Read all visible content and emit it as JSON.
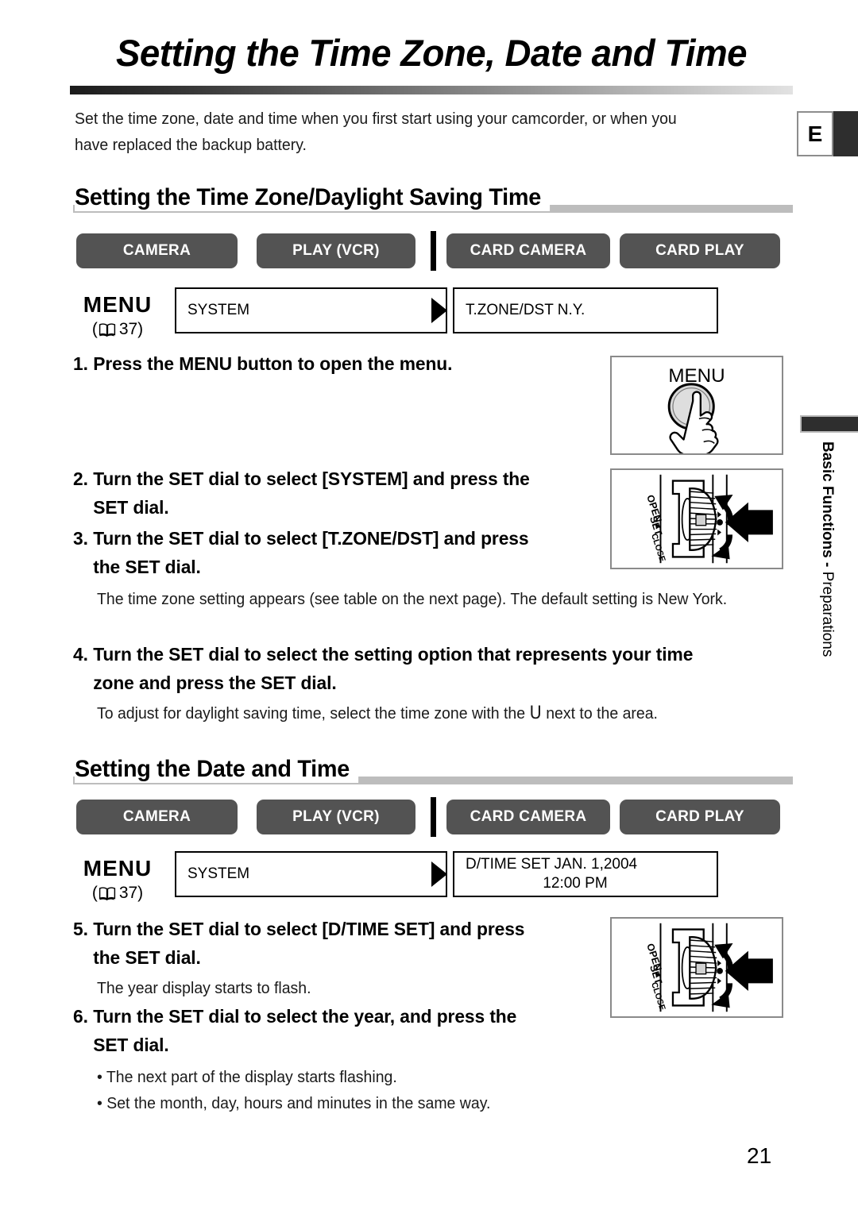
{
  "page": {
    "title": "Setting the Time Zone, Date and Time",
    "intro": "Set the time zone, date and time when you first start using your camcorder, or when you have replaced the backup battery.",
    "number": "21",
    "language_tab": "E"
  },
  "side_tab": {
    "line_bold": "Basic Functions -",
    "line_regular": "Preparations"
  },
  "section1": {
    "heading": "Setting the Time Zone/Daylight Saving Time",
    "modes": [
      {
        "label": "CAMERA"
      },
      {
        "label": "PLAY (VCR)"
      },
      {
        "label": "CARD CAMERA"
      },
      {
        "label": "CARD PLAY"
      }
    ],
    "menu": {
      "label": "MENU",
      "page_ref": "37",
      "box1": "SYSTEM",
      "box2_line1": "T.ZONE/DST  N.Y.",
      "box2_line2": ""
    },
    "steps": [
      {
        "num": "1.",
        "text": "Press the MENU button to open the menu.",
        "text2": "",
        "note": ""
      },
      {
        "num": "2.",
        "text": "Turn the SET dial to select [SYSTEM] and press the",
        "text2": "SET dial.",
        "note": ""
      },
      {
        "num": "3.",
        "text": "Turn the SET dial to select [T.ZONE/DST] and press",
        "text2": "the SET dial.",
        "note": "The time zone setting appears (see table on the next page). The default setting is New York."
      },
      {
        "num": "4.",
        "text": "Turn the SET dial to select the setting option that represents your time",
        "text2": "zone and press the SET dial.",
        "note_pre": "To adjust for daylight saving time, select the time zone with the ",
        "note_symbol": "U",
        "note_post": " next to the area."
      }
    ],
    "illustrations": [
      {
        "name": "menu-button-illustration",
        "caption": "MENU"
      },
      {
        "name": "set-dial-illustration",
        "labels": [
          "OPEN",
          "SET",
          "CLOSE"
        ]
      }
    ]
  },
  "section2": {
    "heading": "Setting the Date and Time",
    "modes": [
      {
        "label": "CAMERA"
      },
      {
        "label": "PLAY (VCR)"
      },
      {
        "label": "CARD CAMERA"
      },
      {
        "label": "CARD PLAY"
      }
    ],
    "menu": {
      "label": "MENU",
      "page_ref": "37",
      "box1": "SYSTEM",
      "box2_line1": "D/TIME SET  JAN. 1,2004",
      "box2_line2": "12:00 PM"
    },
    "steps": [
      {
        "num": "5.",
        "text": "Turn the SET dial to select [D/TIME SET] and press",
        "text2": "the SET dial.",
        "note": "The year display starts to flash."
      },
      {
        "num": "6.",
        "text": "Turn the SET dial to select the year, and press the",
        "text2": "SET dial.",
        "bullets": [
          "• The next part of the display starts flashing.",
          "• Set the month, day, hours and minutes in the same way."
        ]
      }
    ],
    "illustrations": [
      {
        "name": "set-dial-illustration",
        "labels": [
          "OPEN",
          "SET",
          "CLOSE"
        ]
      }
    ]
  },
  "colors": {
    "mode_button": "#535353",
    "heading_rule": "#bdbdbd",
    "tab_dark": "#2e2e2e"
  }
}
